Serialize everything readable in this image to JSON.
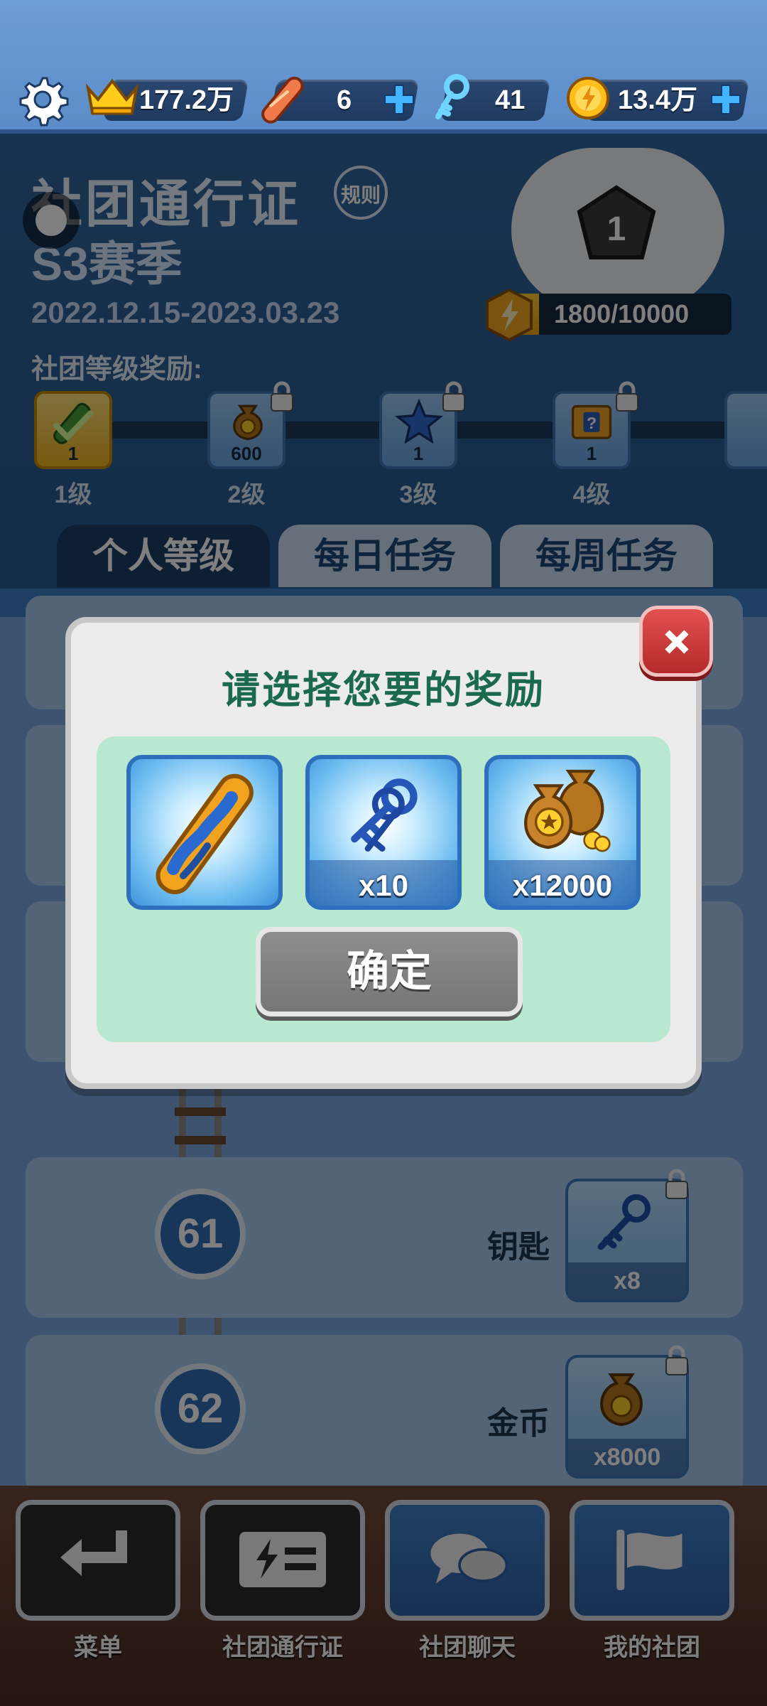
{
  "topbar": {
    "crowns": "177.2万",
    "boards": "6",
    "keys": "41",
    "coins": "13.4万"
  },
  "pass": {
    "title": "社团通行证",
    "rules": "规则",
    "season": "S3赛季",
    "dates": "2022.12.15-2023.03.23",
    "rank": "1",
    "xp": "1800/10000",
    "xp_progress": 0.18,
    "club_rewards_label": "社团等级奖励:",
    "levels": [
      {
        "label": "1级",
        "count": "1",
        "icon": "board-checkmark-icon"
      },
      {
        "label": "2级",
        "count": "600",
        "icon": "coin-bag-icon"
      },
      {
        "label": "3级",
        "count": "1",
        "icon": "star-icon"
      },
      {
        "label": "4级",
        "count": "1",
        "icon": "mystery-box-icon"
      }
    ],
    "tabs": [
      "个人等级",
      "每日任务",
      "每周任务"
    ]
  },
  "rows": [
    {
      "level": "61",
      "name": "钥匙",
      "count": "x8",
      "icon": "keys-icon"
    },
    {
      "level": "62",
      "name": "金币",
      "count": "x8000",
      "icon": "coin-bag-icon"
    }
  ],
  "nav": {
    "menu": "菜单",
    "club_pass": "社团通行证",
    "club_chat": "社团聊天",
    "my_club": "我的社团"
  },
  "modal": {
    "title": "请选择您要的奖励",
    "choices": [
      {
        "icon": "hoverboard-icon",
        "count": ""
      },
      {
        "icon": "keys-icon",
        "count": "x10"
      },
      {
        "icon": "coin-bag-icon",
        "count": "x12000"
      }
    ],
    "confirm": "确定"
  },
  "colors": {
    "accent_green": "#1b6a4e",
    "close_red": "#c83a3a",
    "panel_mint": "#b9e8d1"
  }
}
